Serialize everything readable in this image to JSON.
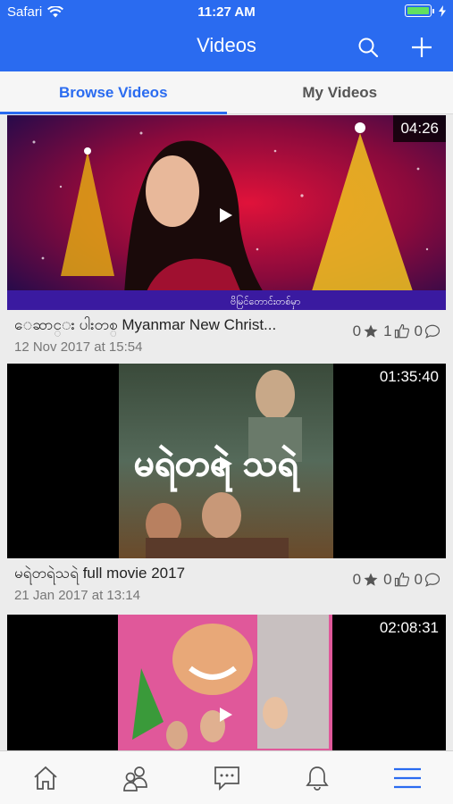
{
  "status_bar": {
    "carrier": "Safari",
    "time": "11:27 AM"
  },
  "header": {
    "title": "Videos"
  },
  "tabs": [
    {
      "label": "Browse Videos",
      "active": true
    },
    {
      "label": "My Videos",
      "active": false
    }
  ],
  "videos": [
    {
      "title": "ေဆာင္း ပါးတစ္ Myanmar New Christ...",
      "date": "12 Nov 2017 at 15:54",
      "duration": "04:26",
      "rating": "0",
      "likes": "1",
      "comments": "0",
      "overlay_caption": "ဗိမြင်တောင်းတစ်မှာ"
    },
    {
      "title": "မရဲတရဲသရဲ full movie 2017",
      "date": "21 Jan 2017 at 13:14",
      "duration": "01:35:40",
      "rating": "0",
      "likes": "0",
      "comments": "0",
      "poster_text": "မရဲတရဲ သရဲ"
    },
    {
      "title": "",
      "date": "",
      "duration": "02:08:31"
    }
  ],
  "colors": {
    "accent": "#2a6bf0",
    "battery": "#61e060"
  },
  "bottom_nav": [
    {
      "icon": "home-icon"
    },
    {
      "icon": "friends-icon"
    },
    {
      "icon": "chat-icon"
    },
    {
      "icon": "bell-icon"
    },
    {
      "icon": "menu-icon"
    }
  ]
}
